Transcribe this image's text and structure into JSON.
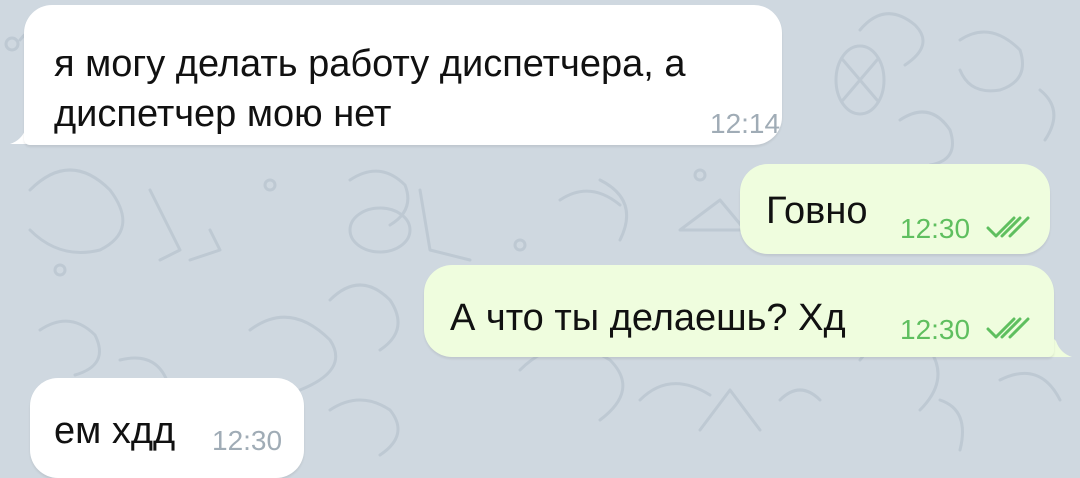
{
  "colors": {
    "chat_background": "#cfd8e0",
    "incoming_bubble": "#ffffff",
    "outgoing_bubble": "#effdde",
    "outgoing_meta": "#5fbf5f",
    "incoming_time": "#a0acb6"
  },
  "messages": [
    {
      "direction": "incoming",
      "text": "я могу делать работу диспетчера, а\nдиспетчер мою нет",
      "time": "12:14"
    },
    {
      "direction": "outgoing",
      "text": "Говно",
      "time": "12:30",
      "status_icon": "double-check-icon"
    },
    {
      "direction": "outgoing",
      "text": "А что ты делаешь? Хд",
      "time": "12:30",
      "status_icon": "double-check-icon"
    },
    {
      "direction": "incoming",
      "text": "ем хдд",
      "time": "12:30"
    }
  ]
}
